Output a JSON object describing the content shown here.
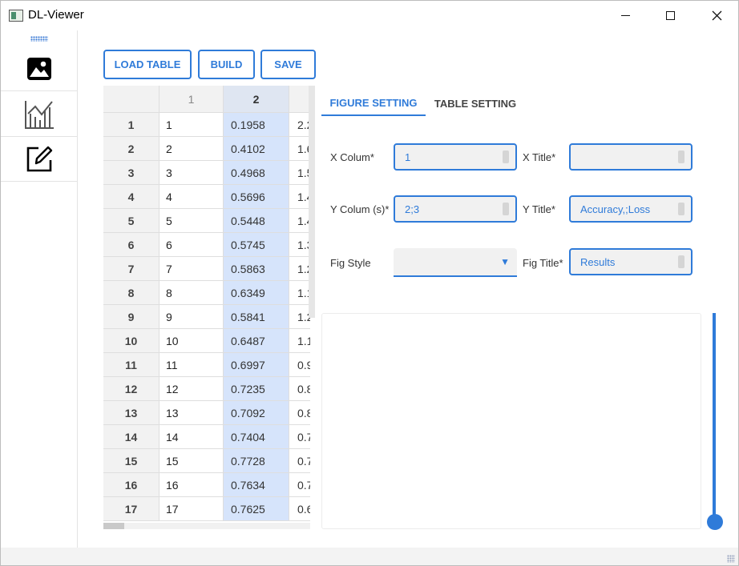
{
  "window": {
    "title": "DL-Viewer"
  },
  "sidebar": {
    "items": [
      {
        "icon": "image-icon"
      },
      {
        "icon": "chart-icon"
      },
      {
        "icon": "edit-icon"
      }
    ]
  },
  "toolbar": {
    "load_label": "LOAD TABLE",
    "build_label": "BUILD",
    "save_label": "SAVE"
  },
  "table": {
    "columns": [
      "1",
      "2"
    ],
    "selected_column": "2",
    "rows": [
      {
        "index": "1",
        "c1": "1",
        "c2": "0.1958",
        "c3": "2.2"
      },
      {
        "index": "2",
        "c1": "2",
        "c2": "0.4102",
        "c3": "1.6"
      },
      {
        "index": "3",
        "c1": "3",
        "c2": "0.4968",
        "c3": "1.5"
      },
      {
        "index": "4",
        "c1": "4",
        "c2": "0.5696",
        "c3": "1.4"
      },
      {
        "index": "5",
        "c1": "5",
        "c2": "0.5448",
        "c3": "1.4"
      },
      {
        "index": "6",
        "c1": "6",
        "c2": "0.5745",
        "c3": "1.3"
      },
      {
        "index": "7",
        "c1": "7",
        "c2": "0.5863",
        "c3": "1.2"
      },
      {
        "index": "8",
        "c1": "8",
        "c2": "0.6349",
        "c3": "1.1"
      },
      {
        "index": "9",
        "c1": "9",
        "c2": "0.5841",
        "c3": "1.2"
      },
      {
        "index": "10",
        "c1": "10",
        "c2": "0.6487",
        "c3": "1.1"
      },
      {
        "index": "11",
        "c1": "11",
        "c2": "0.6997",
        "c3": "0.9"
      },
      {
        "index": "12",
        "c1": "12",
        "c2": "0.7235",
        "c3": "0.8"
      },
      {
        "index": "13",
        "c1": "13",
        "c2": "0.7092",
        "c3": "0.8"
      },
      {
        "index": "14",
        "c1": "14",
        "c2": "0.7404",
        "c3": "0.7"
      },
      {
        "index": "15",
        "c1": "15",
        "c2": "0.7728",
        "c3": "0.7"
      },
      {
        "index": "16",
        "c1": "16",
        "c2": "0.7634",
        "c3": "0.7"
      },
      {
        "index": "17",
        "c1": "17",
        "c2": "0.7625",
        "c3": "0.6"
      }
    ]
  },
  "tabs": {
    "figure_setting": "FIGURE SETTING",
    "table_setting": "TABLE SETTING",
    "active": "FIGURE SETTING"
  },
  "form": {
    "x_column_label": "X Colum*",
    "x_column_value": "1",
    "x_title_label": "X Title*",
    "x_title_value": "",
    "y_column_label": "Y Colum (s)*",
    "y_column_value": "2;3",
    "y_title_label": "Y Title*",
    "y_title_value": "Accuracy,;Loss",
    "fig_style_label": "Fig Style",
    "fig_style_value": "",
    "fig_title_label": "Fig Title*",
    "fig_title_value": "Results"
  },
  "slider": {
    "value": 0
  },
  "colors": {
    "accent": "#2f7bd9",
    "selection": "#d6e4fb"
  }
}
